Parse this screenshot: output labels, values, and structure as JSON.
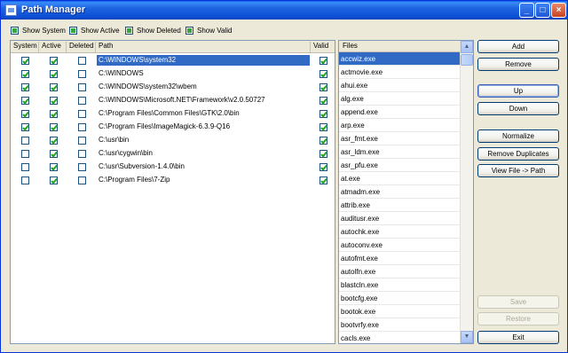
{
  "window": {
    "title": "Path Manager"
  },
  "filters": [
    {
      "label": "Show System",
      "checked": true
    },
    {
      "label": "Show Active",
      "checked": true
    },
    {
      "label": "Show Deleted",
      "checked": true
    },
    {
      "label": "Show Valid",
      "checked": true
    }
  ],
  "grid": {
    "columns": [
      "System",
      "Active",
      "Deleted",
      "Path",
      "Valid"
    ],
    "rows": [
      {
        "system": true,
        "active": true,
        "deleted": false,
        "path": "C:\\WINDOWS\\system32",
        "valid": true,
        "selected": true
      },
      {
        "system": true,
        "active": true,
        "deleted": false,
        "path": "C:\\WINDOWS",
        "valid": true
      },
      {
        "system": true,
        "active": true,
        "deleted": false,
        "path": "C:\\WINDOWS\\system32\\wbem",
        "valid": true
      },
      {
        "system": true,
        "active": true,
        "deleted": false,
        "path": "C:\\WINDOWS\\Microsoft.NET\\Framework\\v2.0.50727",
        "valid": true
      },
      {
        "system": true,
        "active": true,
        "deleted": false,
        "path": "C:\\Program Files\\Common Files\\GTK\\2.0\\bin",
        "valid": true
      },
      {
        "system": true,
        "active": true,
        "deleted": false,
        "path": "C:\\Program Files\\ImageMagick-6.3.9-Q16",
        "valid": true
      },
      {
        "system": false,
        "active": true,
        "deleted": false,
        "path": "C:\\usr\\bin",
        "valid": true
      },
      {
        "system": false,
        "active": true,
        "deleted": false,
        "path": "C:\\usr\\cygwin\\bin",
        "valid": true
      },
      {
        "system": false,
        "active": true,
        "deleted": false,
        "path": "C:\\usr\\Subversion-1.4.0\\bin",
        "valid": true
      },
      {
        "system": false,
        "active": true,
        "deleted": false,
        "path": "C:\\Program Files\\7-Zip",
        "valid": true
      }
    ]
  },
  "files": {
    "header": "Files",
    "items": [
      "accwiz.exe",
      "actmovie.exe",
      "ahui.exe",
      "alg.exe",
      "append.exe",
      "arp.exe",
      "asr_fmt.exe",
      "asr_ldm.exe",
      "asr_pfu.exe",
      "at.exe",
      "atmadm.exe",
      "attrib.exe",
      "auditusr.exe",
      "autochk.exe",
      "autoconv.exe",
      "autofmt.exe",
      "autolfn.exe",
      "blastcln.exe",
      "bootcfg.exe",
      "bootok.exe",
      "bootvrfy.exe",
      "cacls.exe"
    ]
  },
  "buttons": {
    "add": "Add",
    "remove": "Remove",
    "up": "Up",
    "down": "Down",
    "normalize": "Normalize",
    "remove_duplicates": "Remove Duplicates",
    "view_file_path": "View File -> Path",
    "save": "Save",
    "restore": "Restore",
    "exit": "Exit"
  }
}
